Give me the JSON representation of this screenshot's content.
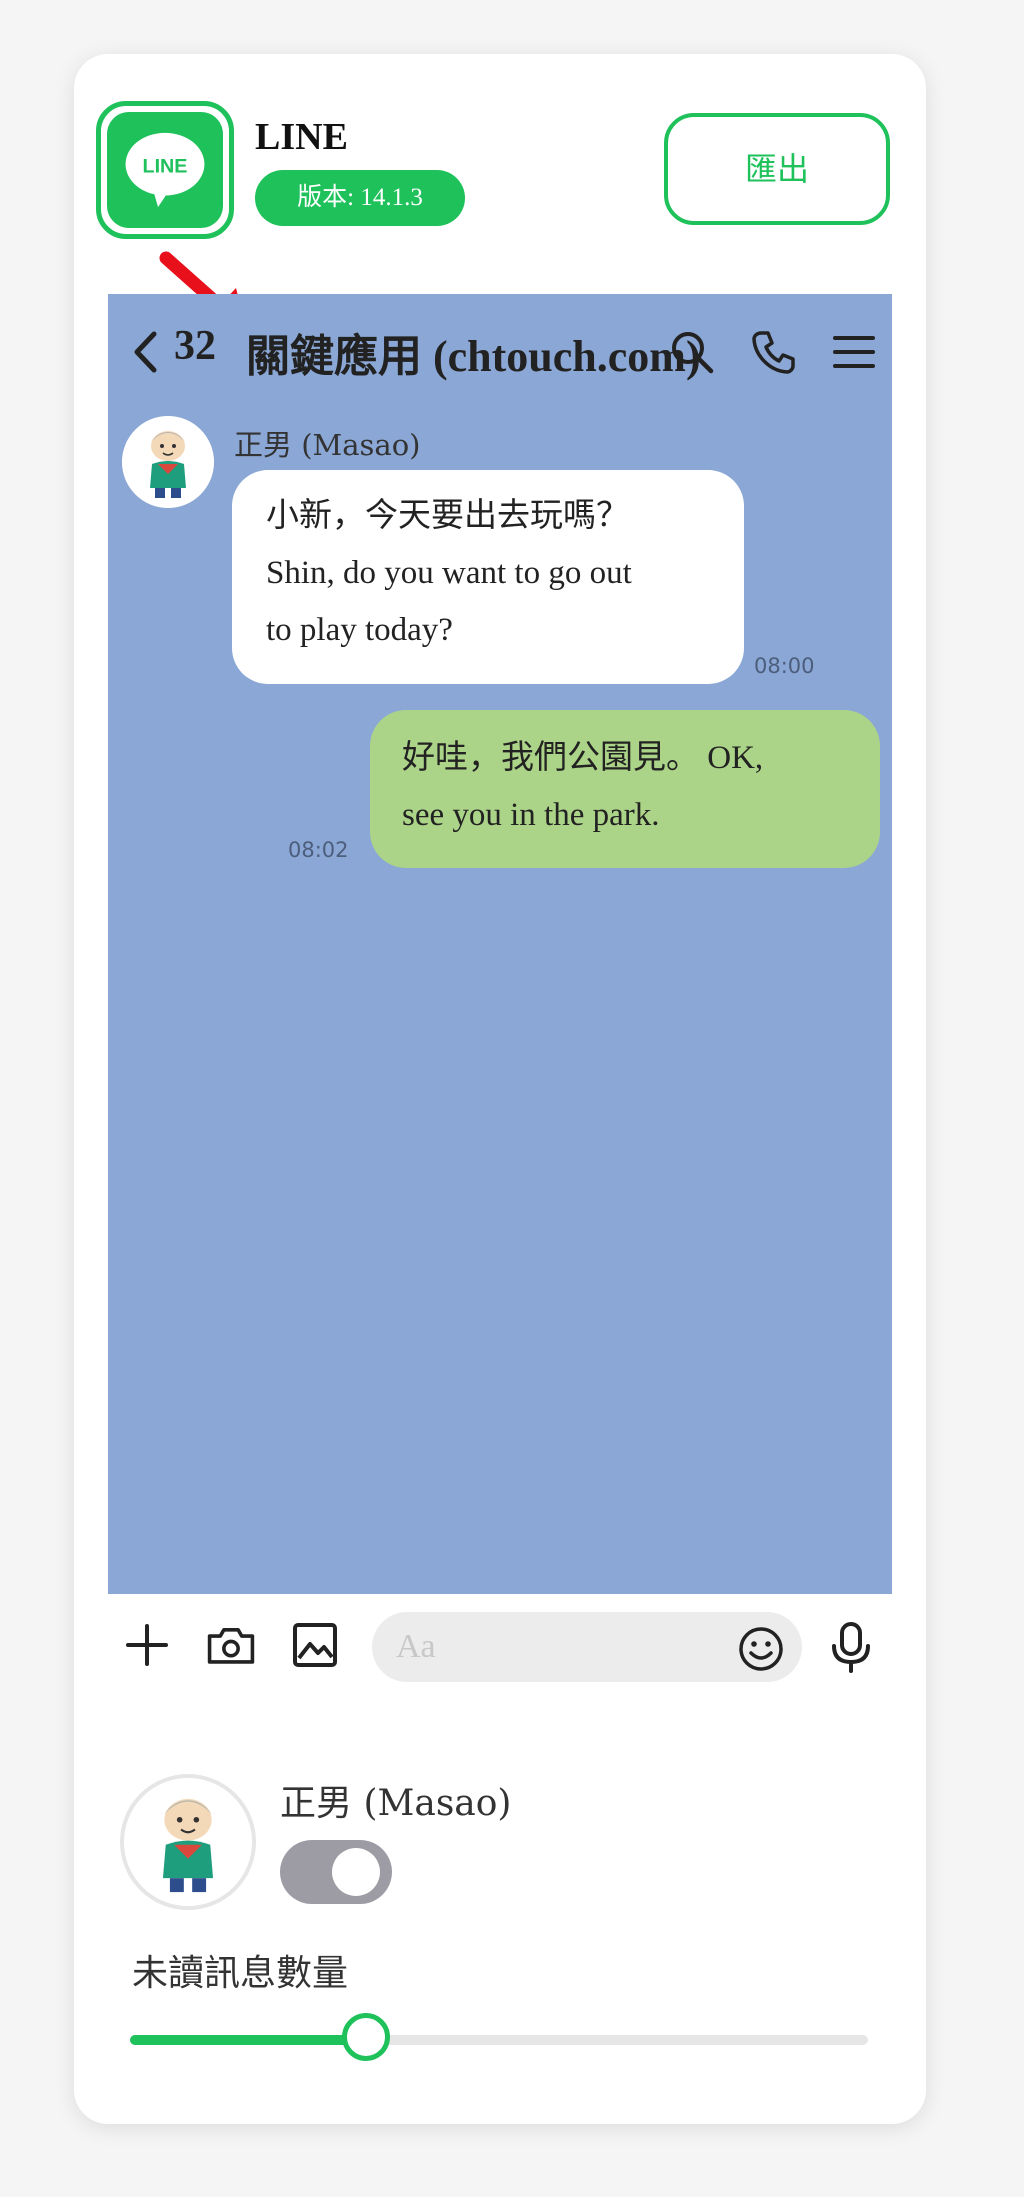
{
  "app": {
    "name": "LINE",
    "logo_text": "LINE",
    "version": "版本: 14.1.3",
    "export_label": "匯出"
  },
  "chat": {
    "unread_count": "32",
    "title": "關鍵應用 (chtouch.com)",
    "messages": [
      {
        "direction": "incoming",
        "sender": "正男 (Masao)",
        "lines": [
          "小新，今天要出去玩嗎？",
          "Shin, do you want to go out",
          "to play today?"
        ],
        "time": "08:00"
      },
      {
        "direction": "outgoing",
        "lines": [
          "好哇，我們公園見。 OK,",
          "see you in the park."
        ],
        "time": "08:02"
      }
    ]
  },
  "input": {
    "placeholder": "Aa"
  },
  "settings": {
    "friend_name": "正男 (Masao)",
    "toggle_on": true,
    "slider_label": "未讀訊息數量",
    "slider_value": 0.32
  },
  "icons": [
    "line-logo-icon",
    "red-arrow-icon",
    "back-icon",
    "search-icon",
    "phone-icon",
    "menu-icon",
    "plus-icon",
    "camera-icon",
    "image-icon",
    "emoji-icon",
    "mic-icon"
  ],
  "colors": {
    "brand_green": "#1ec15a",
    "chat_background": "#8ba7d5",
    "outgoing_bubble": "#acd488",
    "incoming_bubble": "#ffffff",
    "toggle_background": "#9d9ca4"
  }
}
